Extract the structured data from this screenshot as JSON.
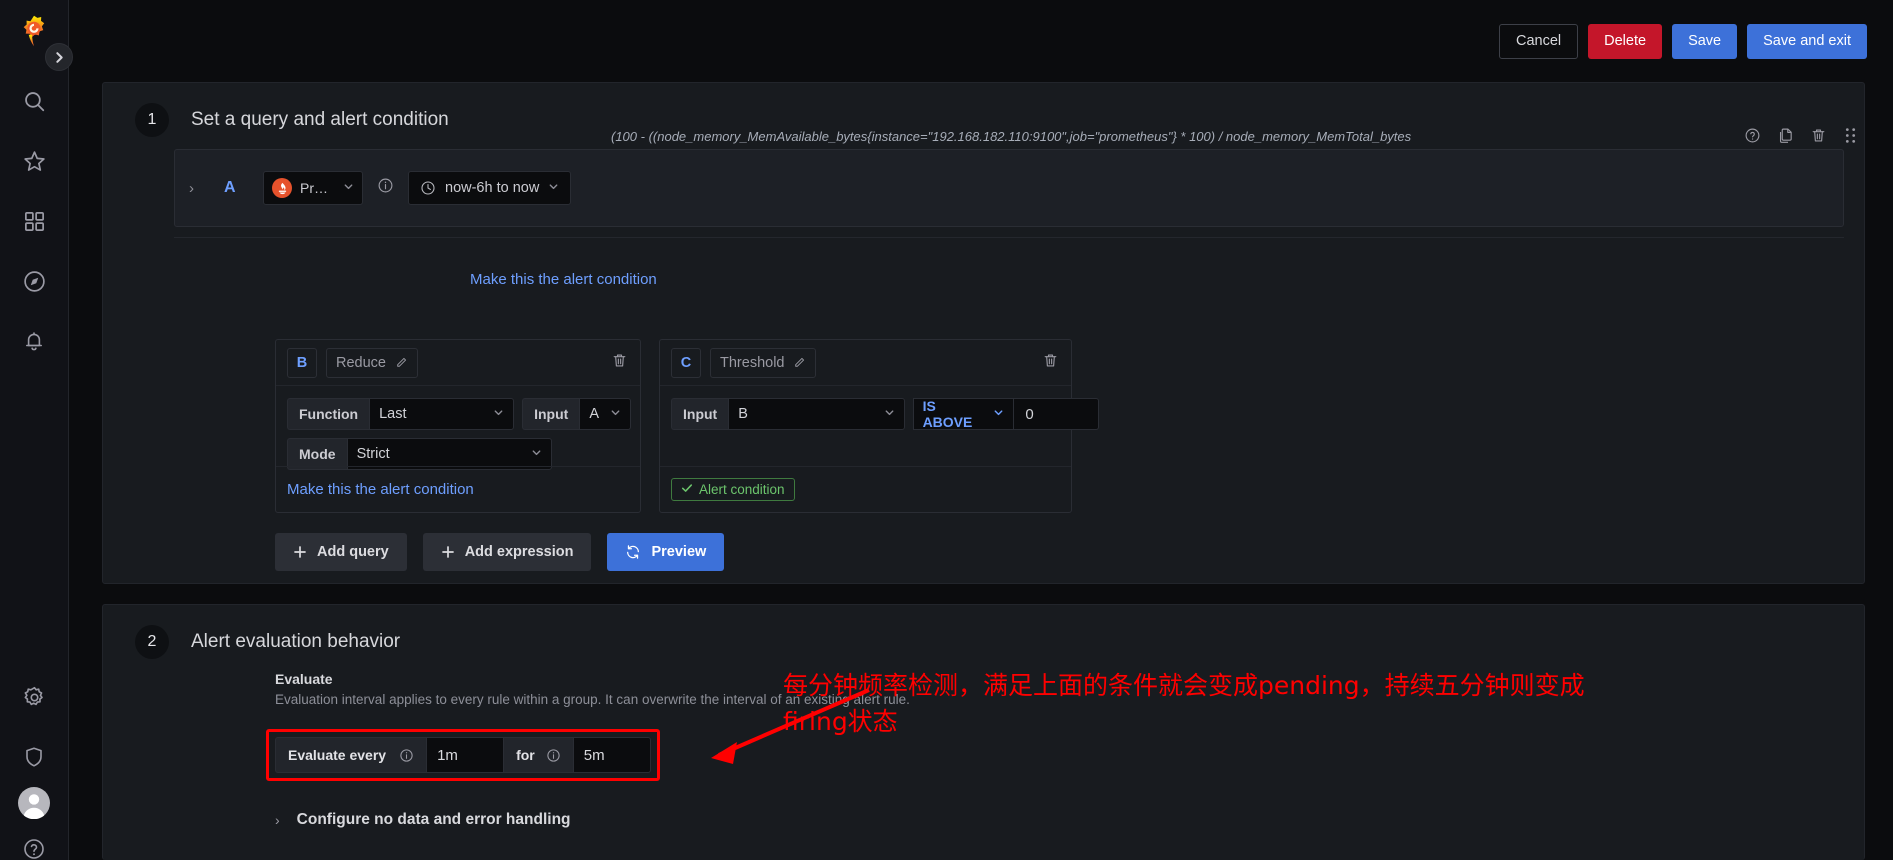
{
  "app": {
    "brand": "grafana-logo"
  },
  "sidebar": {
    "items": [
      {
        "name": "search-icon",
        "label": "Search"
      },
      {
        "name": "star-icon",
        "label": "Starred"
      },
      {
        "name": "dashboards-icon",
        "label": "Dashboards"
      },
      {
        "name": "explore-icon",
        "label": "Explore"
      },
      {
        "name": "bell-icon",
        "label": "Alerting"
      }
    ],
    "bottom_items": [
      {
        "name": "gear-icon",
        "label": "Configuration"
      },
      {
        "name": "shield-icon",
        "label": "Server Admin"
      },
      {
        "name": "avatar",
        "label": "Profile"
      },
      {
        "name": "help-icon",
        "label": "Help"
      }
    ],
    "expand_label": "›"
  },
  "topbar": {
    "cancel_label": "Cancel",
    "delete_label": "Delete",
    "save_label": "Save",
    "save_exit_label": "Save and exit"
  },
  "step1": {
    "number": "1",
    "title": "Set a query and alert condition",
    "query": {
      "ref_id": "A",
      "datasource": "Pr…",
      "time_range": "now-6h to now",
      "expression": "(100 - ((node_memory_MemAvailable_bytes{instance=\"192.168.182.110:9100\",job=\"prometheus\"} * 100) / node_memory_MemTotal_bytes…",
      "make_condition_label": "Make this the alert condition",
      "chevron": "›"
    },
    "reduce": {
      "ref_id": "B",
      "type": "Reduce",
      "function_label": "Function",
      "function_value": "Last",
      "input_label": "Input",
      "input_value": "A",
      "mode_label": "Mode",
      "mode_value": "Strict",
      "make_condition_label": "Make this the alert condition"
    },
    "threshold": {
      "ref_id": "C",
      "type": "Threshold",
      "input_label": "Input",
      "input_value": "B",
      "operator": "IS ABOVE",
      "value": "0",
      "alert_condition_badge": "Alert condition"
    },
    "buttons": {
      "add_query": "Add query",
      "add_expression": "Add expression",
      "preview": "Preview"
    }
  },
  "step2": {
    "number": "2",
    "title": "Alert evaluation behavior",
    "evaluate_label": "Evaluate",
    "evaluate_desc": "Evaluation interval applies to every rule within a group. It can overwrite the interval of an existing alert rule.",
    "evaluate_every_label": "Evaluate every",
    "evaluate_every_value": "1m",
    "for_label": "for",
    "for_value": "5m",
    "collapse_title": "Configure no data and error handling",
    "collapse_chevron": "›"
  },
  "annotation": {
    "line1": "每分钟频率检测，满足上面的条件就会变成pending，持续五分钟则变成",
    "line2": "firing状态",
    "color": "#ff0000"
  },
  "colors": {
    "page_bg": "#0b0c0e",
    "panel_bg": "#181b1f",
    "accent_blue": "#3d71d9",
    "link_blue": "#6e9fff",
    "danger": "#c4162a",
    "green": "#6cc46c",
    "prometheus_orange": "#e6522c"
  }
}
